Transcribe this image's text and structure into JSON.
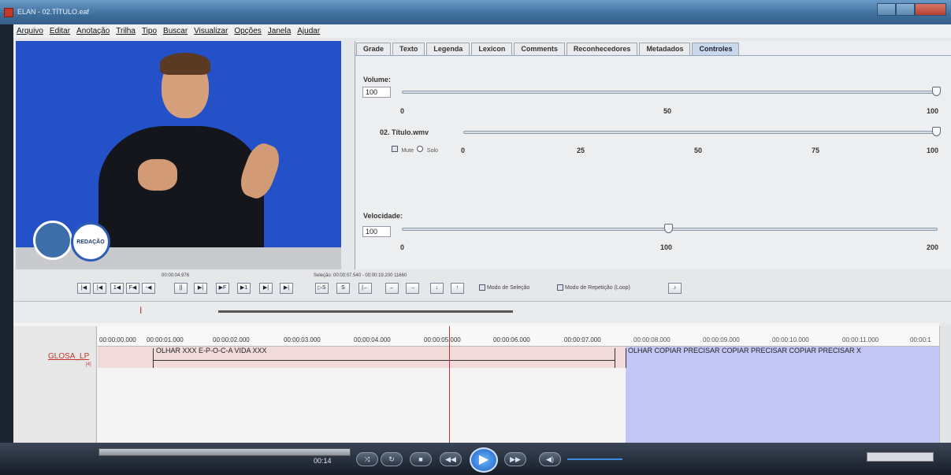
{
  "window": {
    "title": "ELAN - 02.TÍTULO.eaf"
  },
  "menu": [
    "Arquivo",
    "Editar",
    "Anotação",
    "Trilha",
    "Tipo",
    "Buscar",
    "Visualizar",
    "Opções",
    "Janela",
    "Ajudar"
  ],
  "video": {
    "logo_text": "REDAÇÃO"
  },
  "tabs": [
    "Grade",
    "Texto",
    "Legenda",
    "Lexicon",
    "Comments",
    "Reconhecedores",
    "Metadados",
    "Controles"
  ],
  "active_tab": "Controles",
  "controles": {
    "volume": {
      "label": "Volume:",
      "value": "100",
      "scale": [
        "0",
        "50",
        "100"
      ],
      "level_fraction": 1.0
    },
    "media": {
      "filename": "02. Título.wmv",
      "mute_label": "Mute",
      "solo_label": "Solo",
      "scale": [
        "0",
        "25",
        "50",
        "75",
        "100"
      ],
      "level_fraction": 1.0
    },
    "velocidade": {
      "label": "Velocidade:",
      "value": "100",
      "scale": [
        "0",
        "100",
        "200"
      ],
      "level_fraction": 0.5
    }
  },
  "player": {
    "current_time": "00:00:04.976",
    "selection": "Seleção: 00:00:07.540 - 00:00:19.200  11660",
    "buttons": [
      "|◀",
      "|◀",
      "1◀",
      "F◀",
      "-◀",
      "||",
      "▶|",
      "▶F",
      "▶1",
      "▶|",
      "▶|"
    ],
    "sel_buttons": [
      "▷S",
      "S",
      "|←",
      "←",
      "→",
      "↓",
      "↑"
    ],
    "modo_selecao": "Modo de Seleção",
    "modo_repeticao": "Modo de Repetição (Loop)"
  },
  "timeline": {
    "ruler_labels": [
      "00:00:00.000",
      "00:00:01.000",
      "00:00:02.000",
      "00:00:03.000",
      "00:00:04.000",
      "00:00:05.000",
      "00:00:06.000",
      "00:00:07.000",
      "00:00:08.000",
      "00:00:09.000",
      "00:00:10.000",
      "00:00:11.000",
      "00:00:1"
    ],
    "tier_name": "GLOSA_LP",
    "tier_count": "[4]",
    "annotations": [
      "OLHAR XXX E-P-O-C-A VIDA XXX",
      "OLHAR COPIAR PRECISAR COPIAR PRECISAR COPIAR PRECISAR X"
    ]
  },
  "wmp": {
    "time": "00:14"
  }
}
